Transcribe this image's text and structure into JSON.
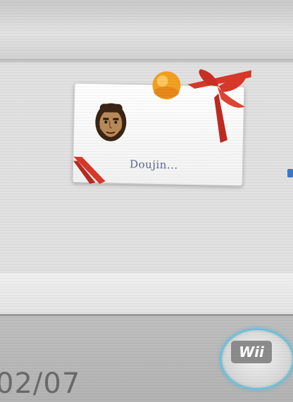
{
  "message_card": {
    "sender_label": "Doujin..."
  },
  "footer": {
    "date": "02/07",
    "wii_button_label": "Wii"
  },
  "colors": {
    "ribbon": "#d8382a",
    "ball": "#f3a020",
    "label_text": "#5a6a8a",
    "wii_ring_glow": "#6fc3dc"
  },
  "icons": [
    "mii-avatar-icon",
    "gift-bow-icon",
    "ribbon-corner-icon"
  ]
}
